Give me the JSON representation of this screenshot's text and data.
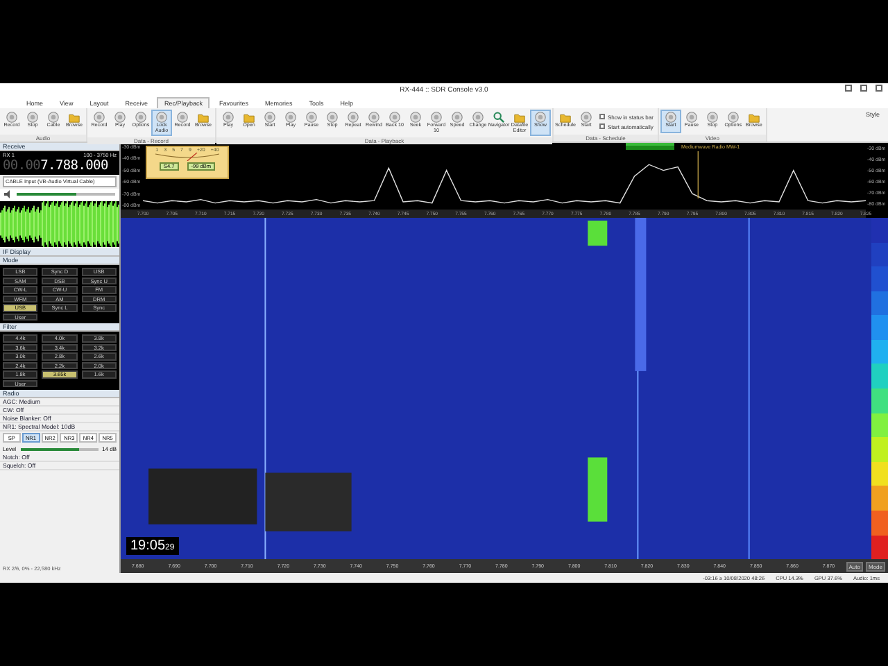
{
  "window": {
    "title": "RX-444 :: SDR Console v3.0"
  },
  "menu_tabs": [
    {
      "label": "Home",
      "selected": false
    },
    {
      "label": "View",
      "selected": false
    },
    {
      "label": "Layout",
      "selected": false
    },
    {
      "label": "Receive",
      "selected": false
    },
    {
      "label": "Rec/Playback",
      "selected": true
    },
    {
      "label": "Favourites",
      "selected": false
    },
    {
      "label": "Memories",
      "selected": false
    },
    {
      "label": "Tools",
      "selected": false
    },
    {
      "label": "Help",
      "selected": false
    }
  ],
  "ribbon_groups": [
    {
      "label": "Audio",
      "items": [
        {
          "kind": "button",
          "label": "Record",
          "on": false
        },
        {
          "kind": "button",
          "label": "Stop",
          "on": false
        },
        {
          "kind": "button",
          "label": "Cable",
          "on": false
        },
        {
          "kind": "folder",
          "label": "Browse",
          "on": false
        }
      ]
    },
    {
      "label": "Data - Record",
      "items": [
        {
          "kind": "button",
          "label": "Record",
          "on": false
        },
        {
          "kind": "button",
          "label": "Play",
          "on": false
        },
        {
          "kind": "button",
          "label": "Options",
          "on": false
        },
        {
          "kind": "button",
          "label": "Lock Audio",
          "on": true
        },
        {
          "kind": "button",
          "label": "Record",
          "on": false
        },
        {
          "kind": "folder",
          "label": "Browse",
          "on": false
        }
      ]
    },
    {
      "label": "Data - Playback",
      "items": [
        {
          "kind": "button",
          "label": "Play",
          "on": false
        },
        {
          "kind": "folder",
          "label": "Open",
          "on": false
        },
        {
          "kind": "button",
          "label": "Start",
          "on": false
        },
        {
          "kind": "button",
          "label": "Play",
          "on": false
        },
        {
          "kind": "button",
          "label": "Pause",
          "on": false
        },
        {
          "kind": "button",
          "label": "Stop",
          "on": false
        },
        {
          "kind": "button",
          "label": "Repeat",
          "on": false
        },
        {
          "kind": "button",
          "label": "Rewind",
          "on": false
        },
        {
          "kind": "button",
          "label": "Back 10",
          "on": false
        },
        {
          "kind": "button",
          "label": "Seek",
          "on": false
        },
        {
          "kind": "button",
          "label": "Forward 10",
          "on": false
        },
        {
          "kind": "button",
          "label": "Speed",
          "on": false
        },
        {
          "kind": "button",
          "label": "Change",
          "on": false
        },
        {
          "kind": "search",
          "label": "Navigator",
          "on": false
        },
        {
          "kind": "folder",
          "label": "Datafile Editor",
          "on": false
        },
        {
          "kind": "button",
          "label": "Show",
          "on": true
        }
      ]
    },
    {
      "label": "Data - Schedule",
      "items": [
        {
          "kind": "folder",
          "label": "Schedule",
          "on": false
        },
        {
          "kind": "button",
          "label": "Start",
          "on": false
        },
        {
          "kind": "checkbox",
          "label": "Show in status bar",
          "checked": false
        },
        {
          "kind": "checkbox",
          "label": "Start automatically",
          "checked": false
        }
      ]
    },
    {
      "label": "Video",
      "items": [
        {
          "kind": "button",
          "label": "Start",
          "on": true
        },
        {
          "kind": "button",
          "label": "Pause",
          "on": false
        },
        {
          "kind": "button",
          "label": "Stop",
          "on": false
        },
        {
          "kind": "button",
          "label": "Options",
          "on": false
        },
        {
          "kind": "folder",
          "label": "Browse",
          "on": false
        }
      ]
    }
  ],
  "style_menu": "Style",
  "receive": {
    "header": "Receive",
    "rx": "RX 1",
    "bandwidth": "100 - 3750 Hz",
    "frequency_dim": "00.00",
    "frequency": "7.788.000",
    "audio_device": "CABLE Input (VB-Audio Virtual Cable)",
    "volume": {
      "level": 0.6
    }
  },
  "if_display": "IF Display",
  "mode": {
    "header": "Mode",
    "buttons": [
      {
        "label": "LSB",
        "selected": false
      },
      {
        "label": "Sync D",
        "selected": false
      },
      {
        "label": "USB",
        "selected": false
      },
      {
        "label": "SAM",
        "selected": false
      },
      {
        "label": "DSB",
        "selected": false
      },
      {
        "label": "Sync U",
        "selected": false
      },
      {
        "label": "CW-L",
        "selected": false
      },
      {
        "label": "CW-U",
        "selected": false
      },
      {
        "label": "FM",
        "selected": false
      },
      {
        "label": "WFM",
        "selected": false
      },
      {
        "label": "AM",
        "selected": false
      },
      {
        "label": "DRM",
        "selected": false
      },
      {
        "label": "USB",
        "selected": true
      },
      {
        "label": "Sync L",
        "selected": false
      },
      {
        "label": "Sync",
        "selected": false
      },
      {
        "label": "User",
        "selected": false
      }
    ]
  },
  "filter": {
    "header": "Filter",
    "buttons": [
      {
        "label": "4.4k",
        "selected": false
      },
      {
        "label": "4.0k",
        "selected": false
      },
      {
        "label": "3.8k",
        "selected": false
      },
      {
        "label": "3.6k",
        "selected": false
      },
      {
        "label": "3.4k",
        "selected": false
      },
      {
        "label": "3.2k",
        "selected": false
      },
      {
        "label": "3.0k",
        "selected": false
      },
      {
        "label": "2.8k",
        "selected": false
      },
      {
        "label": "2.6k",
        "selected": false
      },
      {
        "label": "2.4k",
        "selected": false
      },
      {
        "label": "2.2k",
        "selected": false
      },
      {
        "label": "2.0k",
        "selected": false
      },
      {
        "label": "1.8k",
        "selected": false
      },
      {
        "label": "3.65k",
        "selected": true
      },
      {
        "label": "1.6k",
        "selected": false
      },
      {
        "label": "User",
        "selected": false
      }
    ]
  },
  "radio": {
    "header": "Radio",
    "rows": [
      "AGC: Medium",
      "CW: Off",
      "Noise Blanker: Off",
      "NR1: Spectral Model: 10dB"
    ],
    "nr_buttons": [
      {
        "label": "SP",
        "selected": false
      },
      {
        "label": "NR1",
        "selected": true
      },
      {
        "label": "NR2",
        "selected": false
      },
      {
        "label": "NR3",
        "selected": false
      },
      {
        "label": "NR4",
        "selected": false
      },
      {
        "label": "NR5",
        "selected": false
      }
    ],
    "level_label": "Level",
    "level": {
      "level": 0.75
    },
    "level_reading": "14 dB",
    "more_rows": [
      "Notch: Off",
      "Squelch: Off"
    ]
  },
  "left_status": "RX 2/6, 0% - 22,580 kHz",
  "meter": {
    "scale": [
      "1",
      "3",
      "5",
      "7",
      "9",
      "+20",
      "+40"
    ],
    "readings": [
      "S4.7",
      "-99 dBm"
    ]
  },
  "spectrum": {
    "chart_data": {
      "type": "line",
      "xlim": [
        7.7,
        7.825
      ],
      "ylim": [
        -80,
        -30
      ],
      "yticks": [
        {
          "value": -30,
          "label": "-30 dBm"
        },
        {
          "value": -40,
          "label": "-40 dBm"
        },
        {
          "value": -50,
          "label": "-50 dBm"
        },
        {
          "value": -60,
          "label": "-60 dBm"
        },
        {
          "value": -70,
          "label": "-70 dBm"
        },
        {
          "value": -80,
          "label": "-80 dBm"
        }
      ],
      "xticks": [
        {
          "value": 7.7,
          "label": "7.700"
        },
        {
          "value": 7.705,
          "label": "7.705"
        },
        {
          "value": 7.71,
          "label": "7.710"
        },
        {
          "value": 7.715,
          "label": "7.715"
        },
        {
          "value": 7.72,
          "label": "7.720"
        },
        {
          "value": 7.725,
          "label": "7.725"
        },
        {
          "value": 7.73,
          "label": "7.730"
        },
        {
          "value": 7.735,
          "label": "7.735"
        },
        {
          "value": 7.74,
          "label": "7.740"
        },
        {
          "value": 7.745,
          "label": "7.745"
        },
        {
          "value": 7.75,
          "label": "7.750"
        },
        {
          "value": 7.755,
          "label": "7.755"
        },
        {
          "value": 7.76,
          "label": "7.760"
        },
        {
          "value": 7.765,
          "label": "7.765"
        },
        {
          "value": 7.77,
          "label": "7.770"
        },
        {
          "value": 7.775,
          "label": "7.775"
        },
        {
          "value": 7.78,
          "label": "7.780"
        },
        {
          "value": 7.785,
          "label": "7.785"
        },
        {
          "value": 7.79,
          "label": "7.790"
        },
        {
          "value": 7.795,
          "label": "7.795"
        },
        {
          "value": 7.8,
          "label": "7.800"
        },
        {
          "value": 7.805,
          "label": "7.805"
        },
        {
          "value": 7.81,
          "label": "7.810"
        },
        {
          "value": 7.815,
          "label": "7.815"
        },
        {
          "value": 7.82,
          "label": "7.820"
        },
        {
          "value": 7.825,
          "label": "7.825"
        }
      ],
      "x": [
        7.7,
        7.7025,
        7.705,
        7.7075,
        7.71,
        7.7125,
        7.715,
        7.7175,
        7.72,
        7.7225,
        7.725,
        7.7275,
        7.73,
        7.7325,
        7.735,
        7.7375,
        7.74,
        7.7425,
        7.745,
        7.7475,
        7.75,
        7.7525,
        7.755,
        7.7575,
        7.76,
        7.7625,
        7.765,
        7.7675,
        7.77,
        7.7725,
        7.775,
        7.7775,
        7.78,
        7.7825,
        7.785,
        7.7875,
        7.79,
        7.7925,
        7.795,
        7.7975,
        7.8,
        7.8025,
        7.805,
        7.8075,
        7.81,
        7.8125,
        7.815,
        7.8175,
        7.82,
        7.8225,
        7.825
      ],
      "series": [
        {
          "color": "#dddddd",
          "values": [
            -76,
            -78,
            -76,
            -77,
            -75,
            -78,
            -76,
            -77,
            -76,
            -78,
            -76,
            -77,
            -75,
            -78,
            -76,
            -77,
            -76,
            -48,
            -77,
            -76,
            -78,
            -50,
            -76,
            -77,
            -76,
            -78,
            -76,
            -77,
            -75,
            -78,
            -76,
            -77,
            -76,
            -78,
            -55,
            -45,
            -50,
            -47,
            -70,
            -76,
            -77,
            -76,
            -78,
            -76,
            -77,
            -50,
            -76,
            -78,
            -76,
            -77,
            -76
          ]
        }
      ]
    },
    "right_labels": [
      "-30 dBm",
      "-40 dBm",
      "-50 dBm",
      "-60 dBm",
      "-70 dBm",
      "-80 dBm"
    ],
    "marker_label": "Mediumwave Radio MW-1",
    "right_buttons": [
      "Auto",
      "Mode"
    ]
  },
  "clock": {
    "time": "19:05",
    "seconds": "29"
  },
  "bottom_axis": [
    "7.680",
    "7.690",
    "7.700",
    "7.710",
    "7.720",
    "7.730",
    "7.740",
    "7.750",
    "7.760",
    "7.770",
    "7.780",
    "7.790",
    "7.800",
    "7.810",
    "7.820",
    "7.830",
    "7.840",
    "7.850",
    "7.860",
    "7.870"
  ],
  "status_bar": {
    "clock": "-03:16 ≥ 10/08/2020 48:26",
    "cpu": "CPU 14.3%",
    "gpu": "GPU 37.6%",
    "audio": "Audio: 1ms"
  }
}
